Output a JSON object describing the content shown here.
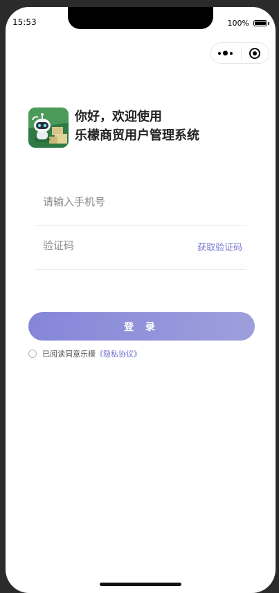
{
  "status_bar": {
    "time": "15:53",
    "battery": "100%"
  },
  "header": {
    "line1": "你好，欢迎使用",
    "line2": "乐檬商贸用户管理系统"
  },
  "form": {
    "phone_placeholder": "请输入手机号",
    "code_placeholder": "验证码",
    "get_code_label": "获取验证码"
  },
  "login_label": "登 录",
  "agreement": {
    "text": "已阅读同意乐檬",
    "link": "《隐私协议》"
  },
  "colors": {
    "accent": "#8586d9",
    "link": "#6f6fd3"
  }
}
